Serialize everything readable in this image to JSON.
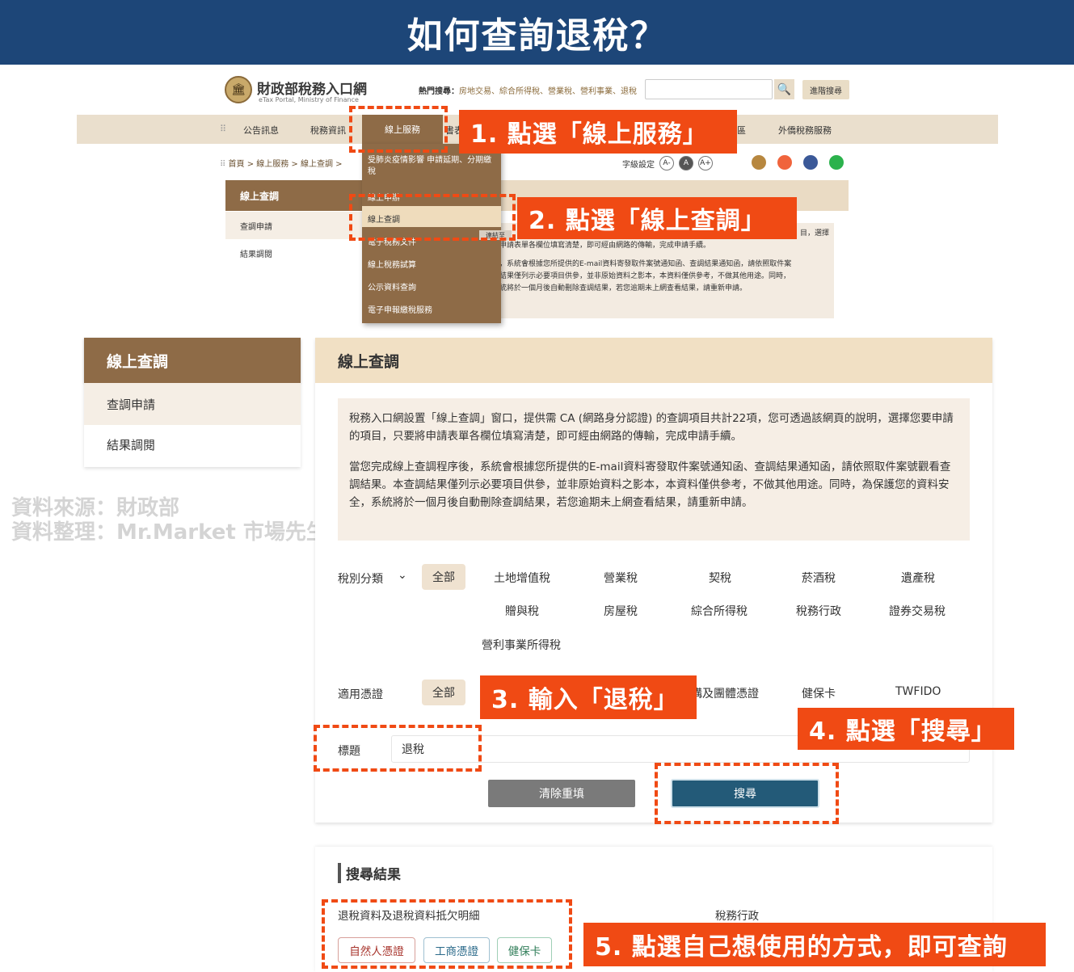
{
  "banner": {
    "title": "如何查詢退稅？"
  },
  "portal": {
    "logo_text": "財政部稅務入口網",
    "logo_sub": "eTax Portal, Ministry of Finance",
    "hot_label": "熱門搜尋：",
    "hot_terms": "房地交易、綜合所得稅、營業稅、營利事業、退稅",
    "adv_search": "進階搜尋",
    "nav": [
      "公告訊息",
      "稅務資訊",
      "線上服務",
      "書表",
      "區",
      "外僑稅務服務"
    ],
    "breadcrumb": "首頁 > 線上服務 > 線上查調 >",
    "font_label": "字級設定",
    "font_buttons": [
      "A-",
      "A",
      "A+"
    ],
    "small_side": {
      "head": "線上查調",
      "items": [
        "查調申請",
        "結果調閱"
      ]
    },
    "dropdown": [
      "受肺炎疫情影響 申請延期、分期繳稅",
      "線上申辦",
      "線上查調",
      "電子稅務文件",
      "線上稅務試算",
      "公示資料查詢",
      "電子申報繳稅服務"
    ],
    "tag_link": "連結至",
    "small_panel": {
      "line1_tail": "目，選擇",
      "lines": [
        "申請表單各欄位填寫清楚，即可經由網路的傳輸，完成申請手續。",
        "，系統會根據您所提供的E-mail資料寄發取件案號通知函、查調結果通知函，請依照取件案",
        "結果僅列示必要項目供參，並非原始資料之影本，本資料僅供參考，不做其他用途。同時，",
        "統將於一個月後自動刪除查調結果，若您逾期未上網查看結果，請重新申請。"
      ]
    }
  },
  "left_menu": {
    "head": "線上查調",
    "items": [
      "查調申請",
      "結果調閱"
    ]
  },
  "watermark": {
    "line1": "資料來源：財政部",
    "line2": "資料整理：Mr.Market 市場先生"
  },
  "main": {
    "head": "線上查調",
    "intro_p1": "稅務入口網設置「線上查調」窗口，提供需 CA (網路身分認證) 的查調項目共計22項，您可透過該網頁的說明，選擇您要申請的項目，只要將申請表單各欄位填寫清楚，即可經由網路的傳輸，完成申請手續。",
    "intro_p2": "當您完成線上查調程序後，系統會根據您所提供的E-mail資料寄發取件案號通知函、查調結果通知函，請依照取件案號觀看查調結果。本查調結果僅列示必要項目供參，並非原始資料之影本，本資料僅供參考，不做其他用途。同時，為保護您的資料安全，系統將於一個月後自動刪除查調結果，若您逾期未上網查看結果，請重新申請。",
    "tax_label": "稅別分類",
    "all_label": "全部",
    "tax_row1": [
      "土地增值稅",
      "營業稅",
      "契稅",
      "菸酒稅",
      "遺產稅"
    ],
    "tax_row2": [
      "贈與稅",
      "房屋稅",
      "綜合所得稅",
      "稅務行政",
      "證券交易稅"
    ],
    "tax_row3": [
      "營利事業所得稅"
    ],
    "cert_label": "適用憑證",
    "cert_opts": [
      "構及團體憑證",
      "健保卡",
      "TWFIDO"
    ],
    "title_label": "標題",
    "title_value": "退稅",
    "clear_btn": "清除重填",
    "search_btn": "搜尋"
  },
  "results": {
    "title": "搜尋結果",
    "name": "退稅資料及退稅資料抵欠明細",
    "category": "稅務行政",
    "buttons": [
      "自然人憑證",
      "工商憑證",
      "健保卡"
    ]
  },
  "callouts": [
    "1. 點選「線上服務」",
    "2. 點選「線上查調」",
    "3. 輸入「退稅」",
    "4. 點選「搜尋」",
    "5. 點選自己想使用的方式，即可查詢"
  ],
  "colors": {
    "banner": "#1d4678",
    "brown": "#8e6b47",
    "accent": "#f04a14",
    "search_btn": "#235a78"
  }
}
